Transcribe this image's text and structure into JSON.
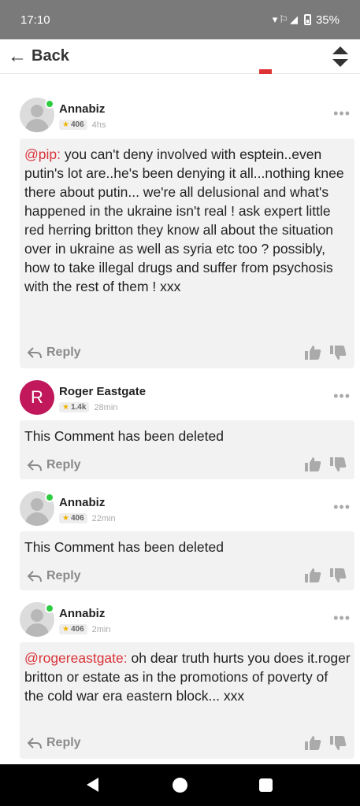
{
  "status_bar": {
    "time": "17:10",
    "battery": "35%"
  },
  "header": {
    "back_label": "Back",
    "sort_icon": "sort-updown-icon"
  },
  "reply_label": "Reply",
  "comments": [
    {
      "author": "Annabiz",
      "rank": "406",
      "time": "4hs",
      "mention": "@pip:",
      "text": "you can't deny involved with esptein..even putin's lot are..he's been denying it all...nothing knee there about putin... we're all delusional and what's happened in the ukraine isn't real ! ask expert little red herring britton they know all about the situation over in ukraine as well as syria etc too ? possibly, how to take illegal drugs and suffer from psychosis with the rest of them ! xxx"
    },
    {
      "author": "Roger Eastgate",
      "avatar_letter": "R",
      "rank": "1.4k",
      "time": "28min",
      "text": "This Comment has been deleted"
    },
    {
      "author": "Annabiz",
      "rank": "406",
      "time": "22min",
      "text": "This Comment has been deleted"
    },
    {
      "author": "Annabiz",
      "rank": "406",
      "time": "2min",
      "mention": "@rogereastgate:",
      "text": "oh dear truth hurts you does it.roger britton or estate as in the promotions of poverty of the cold war era eastern block... xxx"
    }
  ],
  "colors": {
    "mention": "#d9343a",
    "online": "#2ecc40",
    "avatar_letter_bg": "#c0185a",
    "rank_star": "#f0b400"
  }
}
